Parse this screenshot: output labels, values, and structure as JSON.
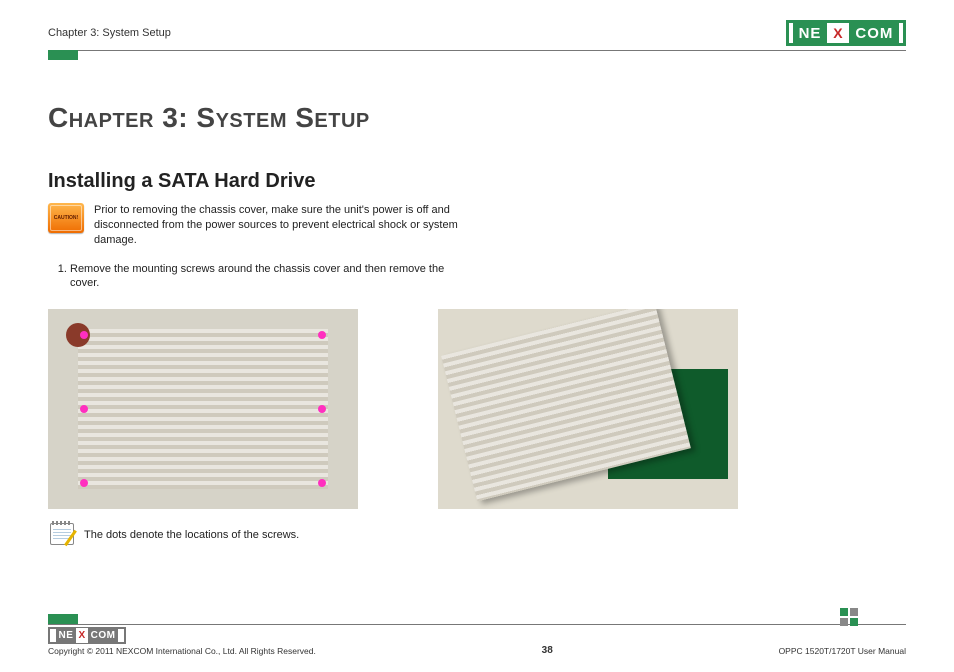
{
  "header": {
    "breadcrumb": "Chapter 3: System Setup",
    "logo": {
      "part1": "NE",
      "part2": "X",
      "part3": "COM"
    }
  },
  "chapter_title": "Chapter 3: System Setup",
  "section_title": "Installing a SATA Hard Drive",
  "caution": {
    "icon_label": "CAUTION!",
    "text": "Prior to removing the chassis cover, make sure the unit's power is off and disconnected from the power sources to prevent electrical shock or system damage."
  },
  "steps": [
    "Remove the mounting screws around the chassis cover and then remove the cover."
  ],
  "note": {
    "text": "The dots denote the locations of the screws."
  },
  "footer": {
    "logo": {
      "part1": "NE",
      "part2": "X",
      "part3": "COM"
    },
    "copyright": "Copyright © 2011 NEXCOM International Co., Ltd. All Rights Reserved.",
    "page_number": "38",
    "doc_id": "OPPC 1520T/1720T User Manual"
  }
}
